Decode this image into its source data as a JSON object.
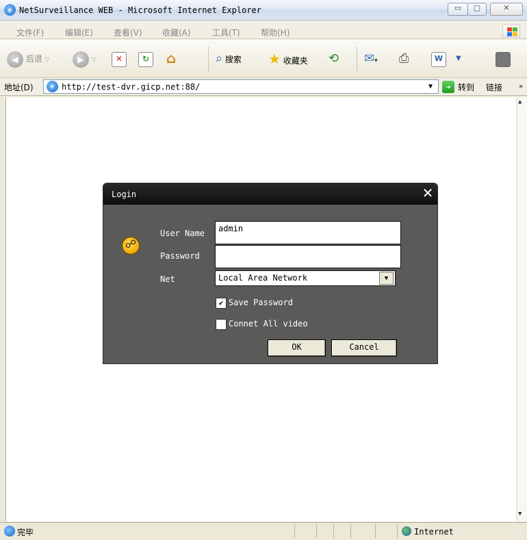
{
  "window": {
    "title": "NetSurveillance WEB - Microsoft Internet Explorer",
    "min_icon": "▭",
    "max_icon": "▢",
    "close_icon": "✕"
  },
  "menu": [
    "文件(F)",
    "编辑(E)",
    "查看(V)",
    "收藏(A)",
    "工具(T)",
    "帮助(H)"
  ],
  "toolbar": {
    "back_label": "后退",
    "search_label": "搜索",
    "favorites_label": "收藏夹"
  },
  "address": {
    "label": "地址(D)",
    "url": "http://test-dvr.gicp.net:88/",
    "go_label": "转到",
    "links_label": "链接"
  },
  "status": {
    "text": "完毕",
    "zone": "Internet"
  },
  "login": {
    "title": "Login",
    "username_label": "User Name",
    "username_value": "admin",
    "password_label": "Password",
    "password_value": "",
    "net_label": "Net",
    "net_value": "Local Area Network",
    "save_password_label": "Save Password",
    "save_password_checked": "✔",
    "connect_all_label": "Connet All video",
    "ok_label": "OK",
    "cancel_label": "Cancel"
  }
}
